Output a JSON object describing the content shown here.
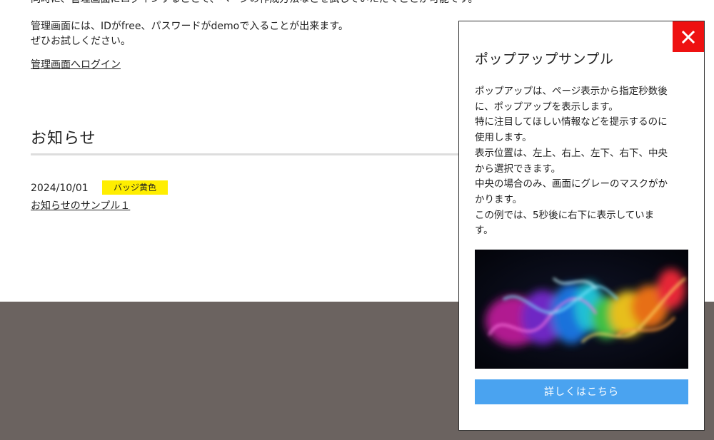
{
  "main": {
    "intro_cut_line": "同時に、管理画面にログインすることで、ページの作成方法などを試していただくことが可能です。",
    "intro_lines": [
      "管理画面には、IDがfree、パスワードがdemoで入ることが出来ます。",
      "ぜひお試しください。"
    ],
    "login_link": "管理画面へログイン"
  },
  "news": {
    "heading": "お知らせ",
    "items": [
      {
        "date": "2024/10/01",
        "badge": "バッジ黄色",
        "title": "お知らせのサンプル１"
      }
    ]
  },
  "popup": {
    "title": "ポップアップサンプル",
    "body_lines": [
      "ポップアップは、ページ表示から指定秒数後",
      "に、ポップアップを表示します。",
      "特に注目してほしい情報などを提示するのに",
      "使用します。",
      "表示位置は、左上、右上、左下、右下、中央",
      "から選択できます。",
      "中央の場合のみ、画面にグレーのマスクがか",
      "かります。",
      "この例では、5秒後に右下に表示していま",
      "す。"
    ],
    "cta_label": "詳しくはこちら",
    "close_icon": "close-icon",
    "image_icon": "colorful-smoke-image"
  },
  "colors": {
    "badge": "#ffee00",
    "close_button": "#ee1111",
    "cta_button": "#4aa3f0",
    "footer_band": "#6b6360",
    "rule": "#dddddd"
  }
}
